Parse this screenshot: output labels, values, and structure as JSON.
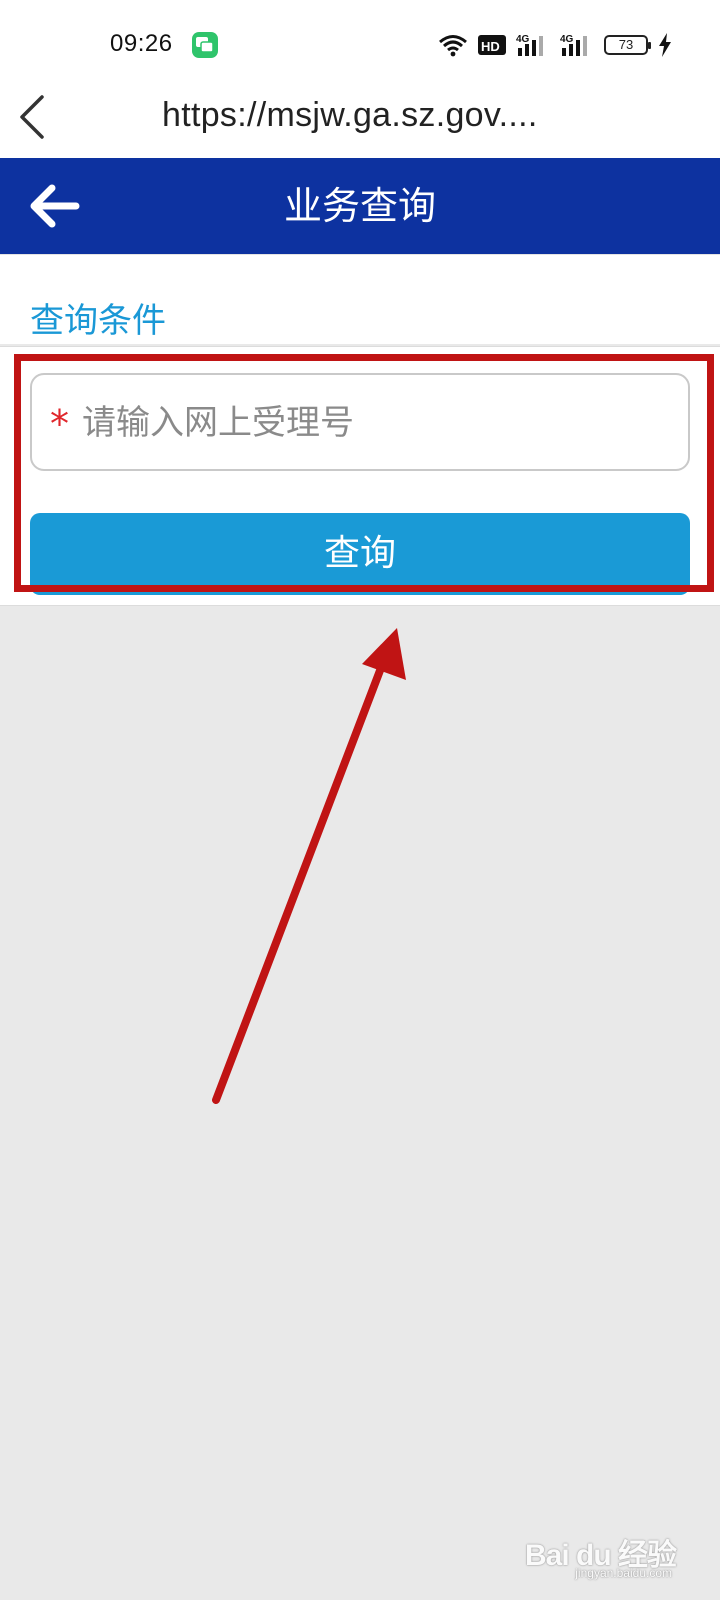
{
  "status_bar": {
    "time": "09:26",
    "battery": "73",
    "network_1": "4G",
    "network_2": "4G",
    "hd": "HD"
  },
  "browser": {
    "url": "https://msjw.ga.sz.gov...."
  },
  "header": {
    "title": "业务查询"
  },
  "section": {
    "label": "查询条件"
  },
  "form": {
    "required_mark": "*",
    "acceptance_number_placeholder": "请输入网上受理号",
    "acceptance_number_value": "",
    "submit_label": "查询"
  },
  "watermark": {
    "brand": "Bai du 经验",
    "sub": "jingyan.baidu.com"
  },
  "colors": {
    "header_bg": "#0d32a0",
    "accent_blue": "#1a9ad6",
    "annotation_red": "#c01414",
    "required_red": "#e0262b"
  }
}
